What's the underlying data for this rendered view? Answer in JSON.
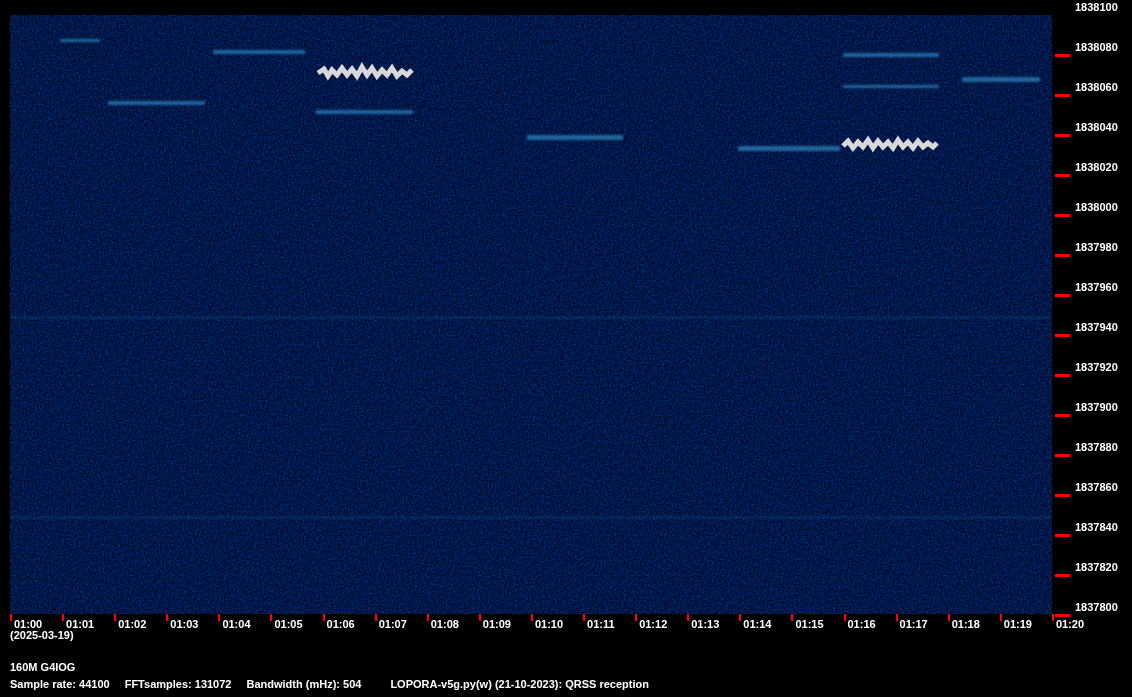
{
  "frequency_axis": {
    "labels": [
      "1838100",
      "1838080",
      "1838060",
      "1838040",
      "1838020",
      "1838000",
      "1837980",
      "1837960",
      "1837940",
      "1837920",
      "1837900",
      "1837880",
      "1837860",
      "1837840",
      "1837820",
      "1837800"
    ]
  },
  "time_axis": {
    "labels": [
      "01:00",
      "01:01",
      "01:02",
      "01:03",
      "01:04",
      "01:05",
      "01:06",
      "01:07",
      "01:08",
      "01:09",
      "01:10",
      "01:11",
      "01:12",
      "01:13",
      "01:14",
      "01:15",
      "01:16",
      "01:17",
      "01:18",
      "01:19",
      "01:20"
    ],
    "date": "(2025-03-19)"
  },
  "station": "160M G4IOG",
  "info": [
    {
      "kind": "setting",
      "text": "Sample rate: 44100"
    },
    {
      "kind": "setting",
      "text": "FFTsamples: 131072"
    },
    {
      "kind": "setting",
      "text": "Bandwidth (mHz): 504"
    },
    {
      "kind": "program",
      "text": "LOPORA-v5g.py(w) (21-10-2023): QRSS reception"
    }
  ]
}
